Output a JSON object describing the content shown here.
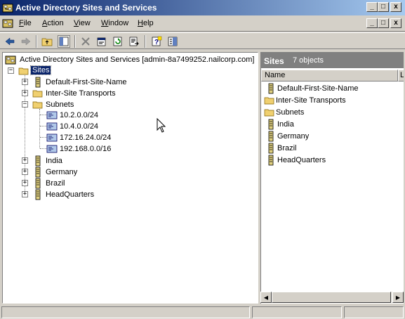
{
  "window": {
    "title": "Active Directory Sites and Services",
    "controls": {
      "minimize": "_",
      "maximize": "□",
      "close": "x"
    }
  },
  "menu": [
    {
      "label": "File",
      "mnemonic": "F",
      "rest": "ile"
    },
    {
      "label": "Action",
      "mnemonic": "A",
      "rest": "ction"
    },
    {
      "label": "View",
      "mnemonic": "V",
      "rest": "iew"
    },
    {
      "label": "Window",
      "mnemonic": "W",
      "rest": "indow"
    },
    {
      "label": "Help",
      "mnemonic": "H",
      "rest": "elp"
    }
  ],
  "toolbar": {
    "icons": [
      "back-arrow-icon",
      "forward-arrow-icon",
      "up-folder-icon",
      "show-hide-tree-icon",
      "delete-icon",
      "properties-icon",
      "refresh-icon",
      "export-list-icon",
      "help-icon",
      "mmc-panel-icon"
    ]
  },
  "tree": {
    "root": "Active Directory Sites and Services [admin-8a7499252.nailcorp.com]",
    "sites": "Sites",
    "items": {
      "default_site": "Default-First-Site-Name",
      "inter_site": "Inter-Site Transports",
      "subnets": "Subnets",
      "subnet_list": [
        "10.2.0.0/24",
        "10.4.0.0/24",
        "172.16.24.0/24",
        "192.168.0.0/16"
      ],
      "india": "India",
      "germany": "Germany",
      "brazil": "Brazil",
      "headquarters": "HeadQuarters"
    },
    "expanders": {
      "plus": "+",
      "minus": "−"
    }
  },
  "right_pane": {
    "title": "Sites",
    "count": "7 objects",
    "columns": [
      "Name",
      "L"
    ],
    "items": [
      {
        "label": "Default-First-Site-Name",
        "icon": "site-icon"
      },
      {
        "label": "Inter-Site Transports",
        "icon": "folder-icon"
      },
      {
        "label": "Subnets",
        "icon": "folder-icon"
      },
      {
        "label": "India",
        "icon": "site-icon"
      },
      {
        "label": "Germany",
        "icon": "site-icon"
      },
      {
        "label": "Brazil",
        "icon": "site-icon"
      },
      {
        "label": "HeadQuarters",
        "icon": "site-icon"
      }
    ]
  },
  "scrollbar": {
    "left_arrow": "◀",
    "right_arrow": "▶"
  },
  "colors": {
    "titlebar_start": "#0a246a",
    "titlebar_end": "#a6caf0",
    "selection": "#0a246a",
    "face": "#d4d0c8",
    "pane_header": "#808080"
  }
}
